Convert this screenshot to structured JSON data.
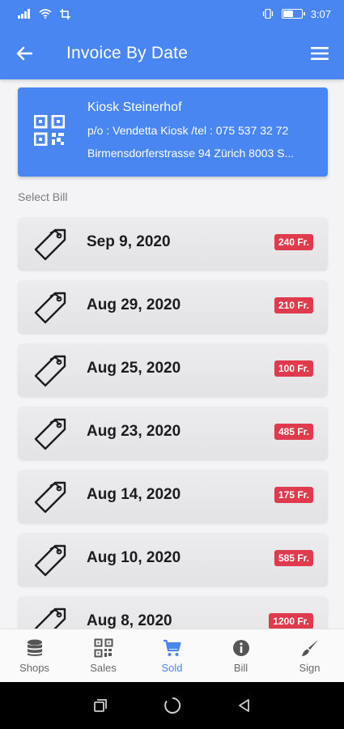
{
  "status_bar": {
    "time": "3:07"
  },
  "app_bar": {
    "title": "Invoice By Date"
  },
  "shop": {
    "name": "Kiosk Steinerhof",
    "owner_line": "p/o : Vendetta Kiosk /tel : 075 537 32 72",
    "address": "Birmensdorferstrasse 94 Zürich 8003 S..."
  },
  "section_label": "Select Bill",
  "bills": [
    {
      "date": "Sep 9, 2020",
      "amount": "240 Fr."
    },
    {
      "date": "Aug 29, 2020",
      "amount": "210 Fr."
    },
    {
      "date": "Aug 25, 2020",
      "amount": "100 Fr."
    },
    {
      "date": "Aug 23, 2020",
      "amount": "485 Fr."
    },
    {
      "date": "Aug 14, 2020",
      "amount": "175 Fr."
    },
    {
      "date": "Aug 10, 2020",
      "amount": "585 Fr."
    },
    {
      "date": "Aug 8, 2020",
      "amount": "1200 Fr."
    }
  ],
  "bottom_nav": [
    {
      "label": "Shops",
      "icon": "database-icon"
    },
    {
      "label": "Sales",
      "icon": "qr-code-icon"
    },
    {
      "label": "Sold",
      "icon": "cart-icon",
      "active": true
    },
    {
      "label": "Bill",
      "icon": "info-icon"
    },
    {
      "label": "Sign",
      "icon": "brush-icon"
    }
  ],
  "colors": {
    "primary": "#4a86f2",
    "badge": "#e03b4d",
    "active_tab": "#4a86f2"
  }
}
